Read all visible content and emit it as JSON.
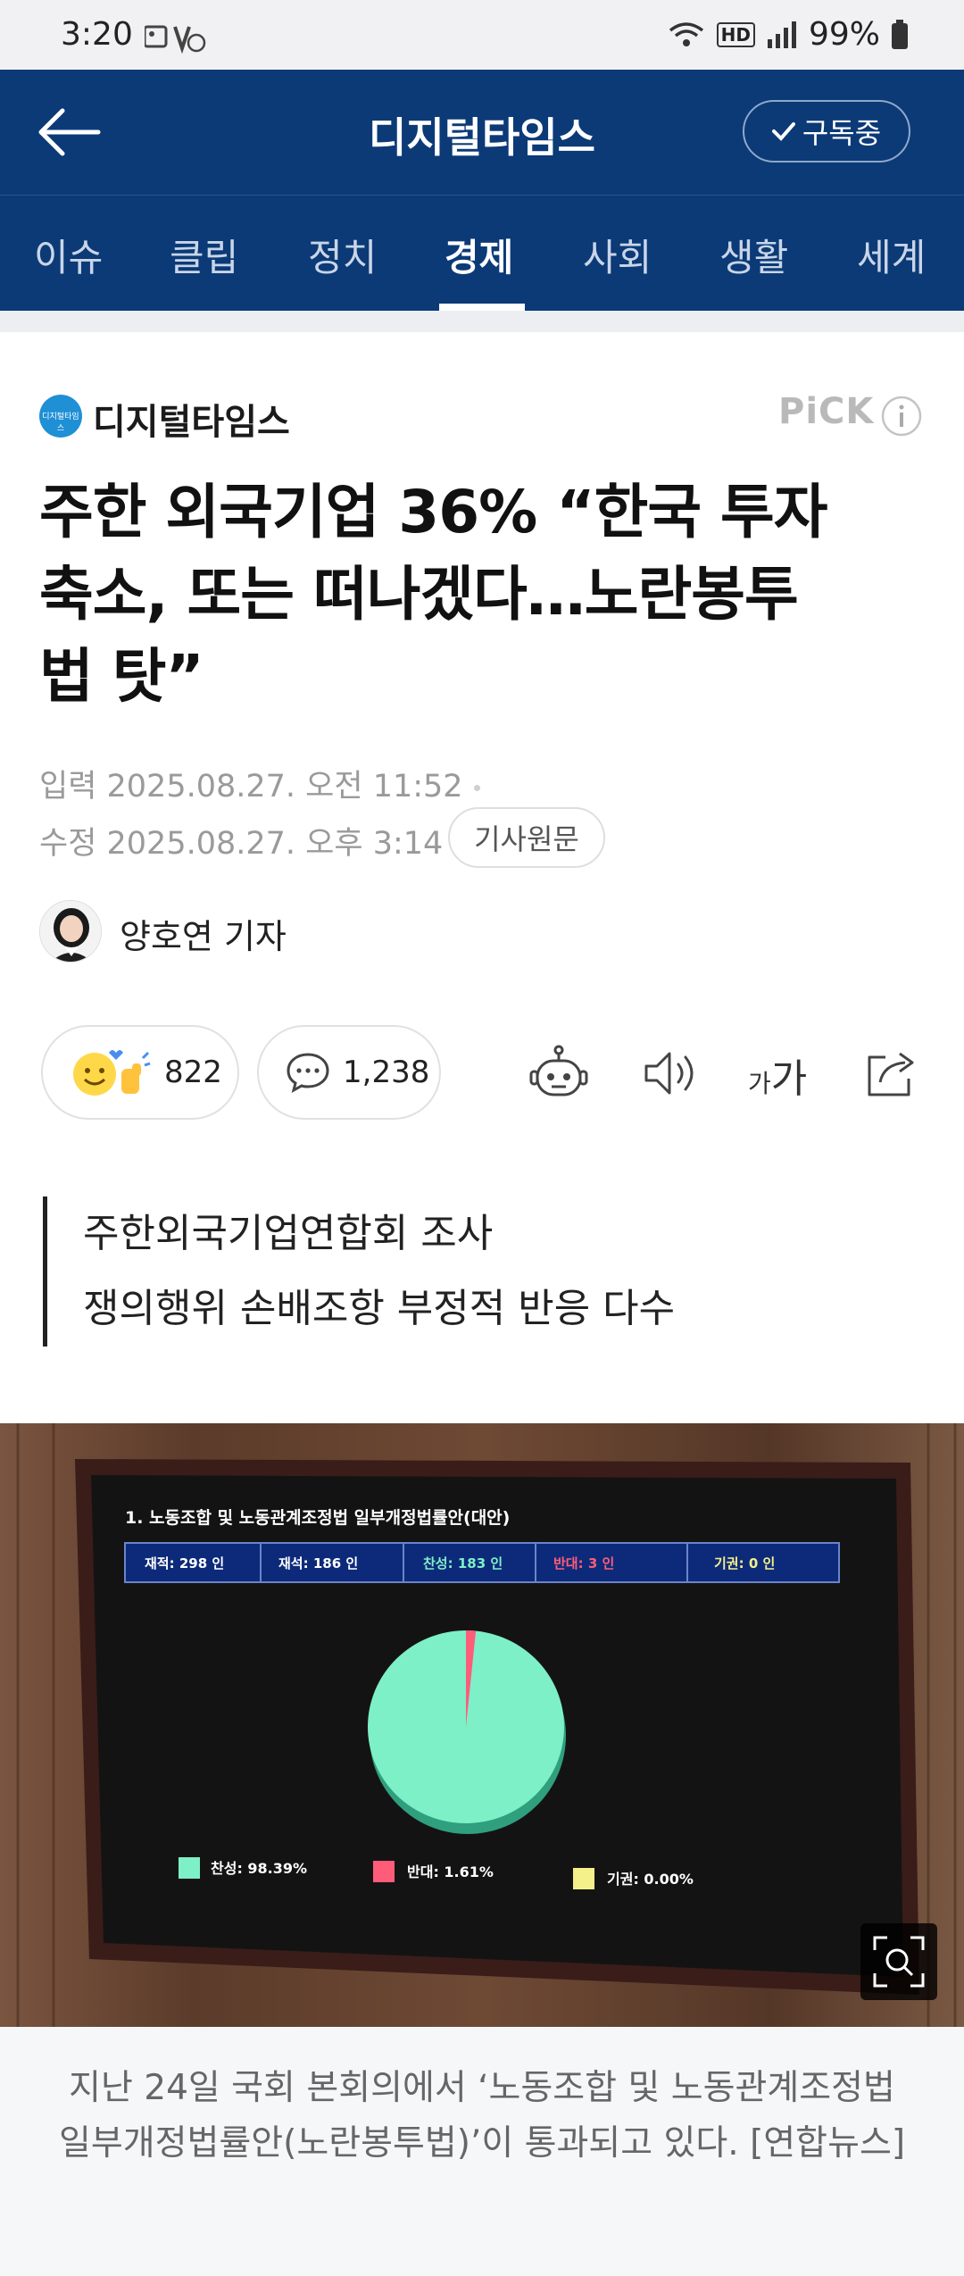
{
  "status_bar": {
    "time": "3:20",
    "battery": "99%",
    "hd_badge": "HD"
  },
  "header": {
    "title": "디지털타임스",
    "subscribe_label": "구독중",
    "back_icon": "arrow-left-icon"
  },
  "categories": {
    "items": [
      "이슈",
      "클립",
      "정치",
      "경제",
      "사회",
      "생활",
      "세계"
    ],
    "active": "경제"
  },
  "publisher": {
    "name": "디지털타임스",
    "logo_text": "디지털타임스",
    "badge": "PiCK"
  },
  "article": {
    "headline_lines": [
      "주한 외국기업 36% “한국 투자",
      "축소, 또는 떠나겠다…노란봉투",
      "법 탓”"
    ],
    "input_date": "입력 2025.08.27. 오전 11:52",
    "modified_date": "수정 2025.08.27. 오후 3:14",
    "original_button": "기사원문",
    "reporter": "양호연 기자",
    "reactions_count": "822",
    "comments_count": "1,238",
    "font_size_label_small": "가",
    "font_size_label_large": "가",
    "summary_lines": [
      "주한외국기업연합회 조사",
      "쟁의행위 손배조항 부정적 반응 다수"
    ],
    "caption": "지난 24일 국회 본회의에서 ‘노동조합 및 노동관계조정법 일부개정법률안(노란봉투법)’이 통과되고 있다. [연합뉴스]"
  },
  "vote_board": {
    "title": "1. 노동조합 및 노동관계조정법 일부개정법률안(대안)",
    "stats": [
      {
        "label": "재적: 298 인"
      },
      {
        "label": "재석: 186 인"
      },
      {
        "label": "찬성: 183 인"
      },
      {
        "label": "반대:   3 인"
      },
      {
        "label": "기권:   0 인"
      }
    ],
    "legend": [
      {
        "label": "찬성: 98.39%",
        "color": "#7df0c8"
      },
      {
        "label": "반대: 1.61%",
        "color": "#ff5c7a"
      },
      {
        "label": "기권: 0.00%",
        "color": "#f4f08a"
      }
    ],
    "pie": {
      "yes_pct": 98.39,
      "no_pct": 1.61,
      "abstain_pct": 0.0
    }
  },
  "colors": {
    "header_bg": "#0b3a77",
    "accent_blue": "#1f8fd6"
  }
}
